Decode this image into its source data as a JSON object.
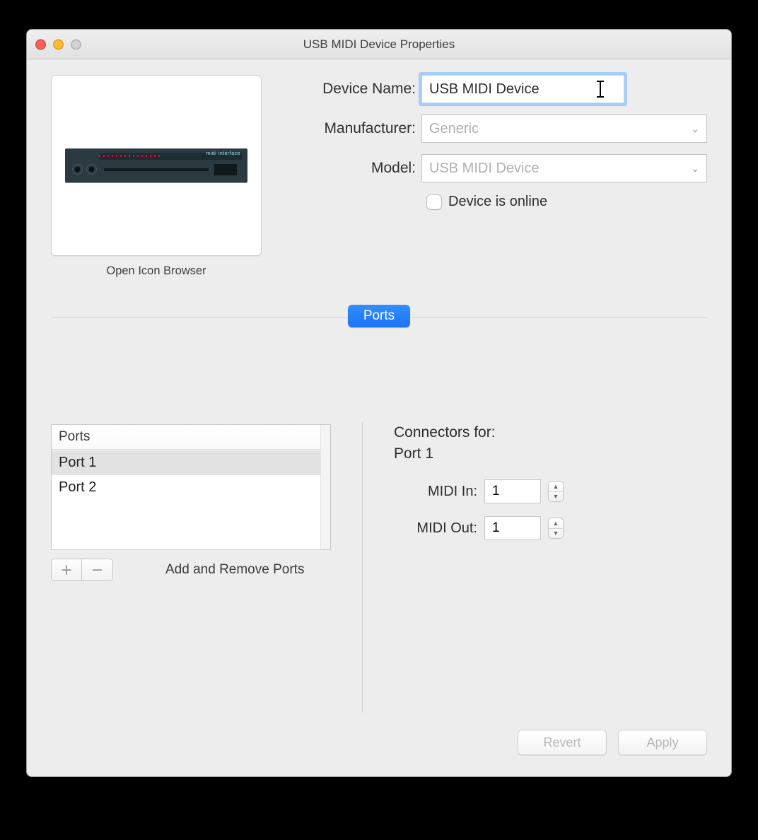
{
  "window": {
    "title": "USB MIDI Device Properties"
  },
  "iconBrowser": {
    "label": "Open Icon Browser",
    "deviceTag": "midi interface"
  },
  "fields": {
    "deviceNameLabel": "Device Name:",
    "deviceNameValue": "USB MIDI Device",
    "manufacturerLabel": "Manufacturer:",
    "manufacturerPlaceholder": "Generic",
    "modelLabel": "Model:",
    "modelPlaceholder": "USB MIDI Device",
    "onlineLabel": "Device is online",
    "onlineChecked": false
  },
  "tabs": {
    "ports": "Ports"
  },
  "portsTable": {
    "header": "Ports",
    "rows": [
      "Port 1",
      "Port 2"
    ],
    "selectedIndex": 0,
    "addRemoveLabel": "Add and Remove Ports"
  },
  "connectors": {
    "title": "Connectors for:",
    "subtitle": "Port 1",
    "midiInLabel": "MIDI In:",
    "midiInValue": "1",
    "midiOutLabel": "MIDI Out:",
    "midiOutValue": "1"
  },
  "buttons": {
    "revert": "Revert",
    "apply": "Apply"
  }
}
